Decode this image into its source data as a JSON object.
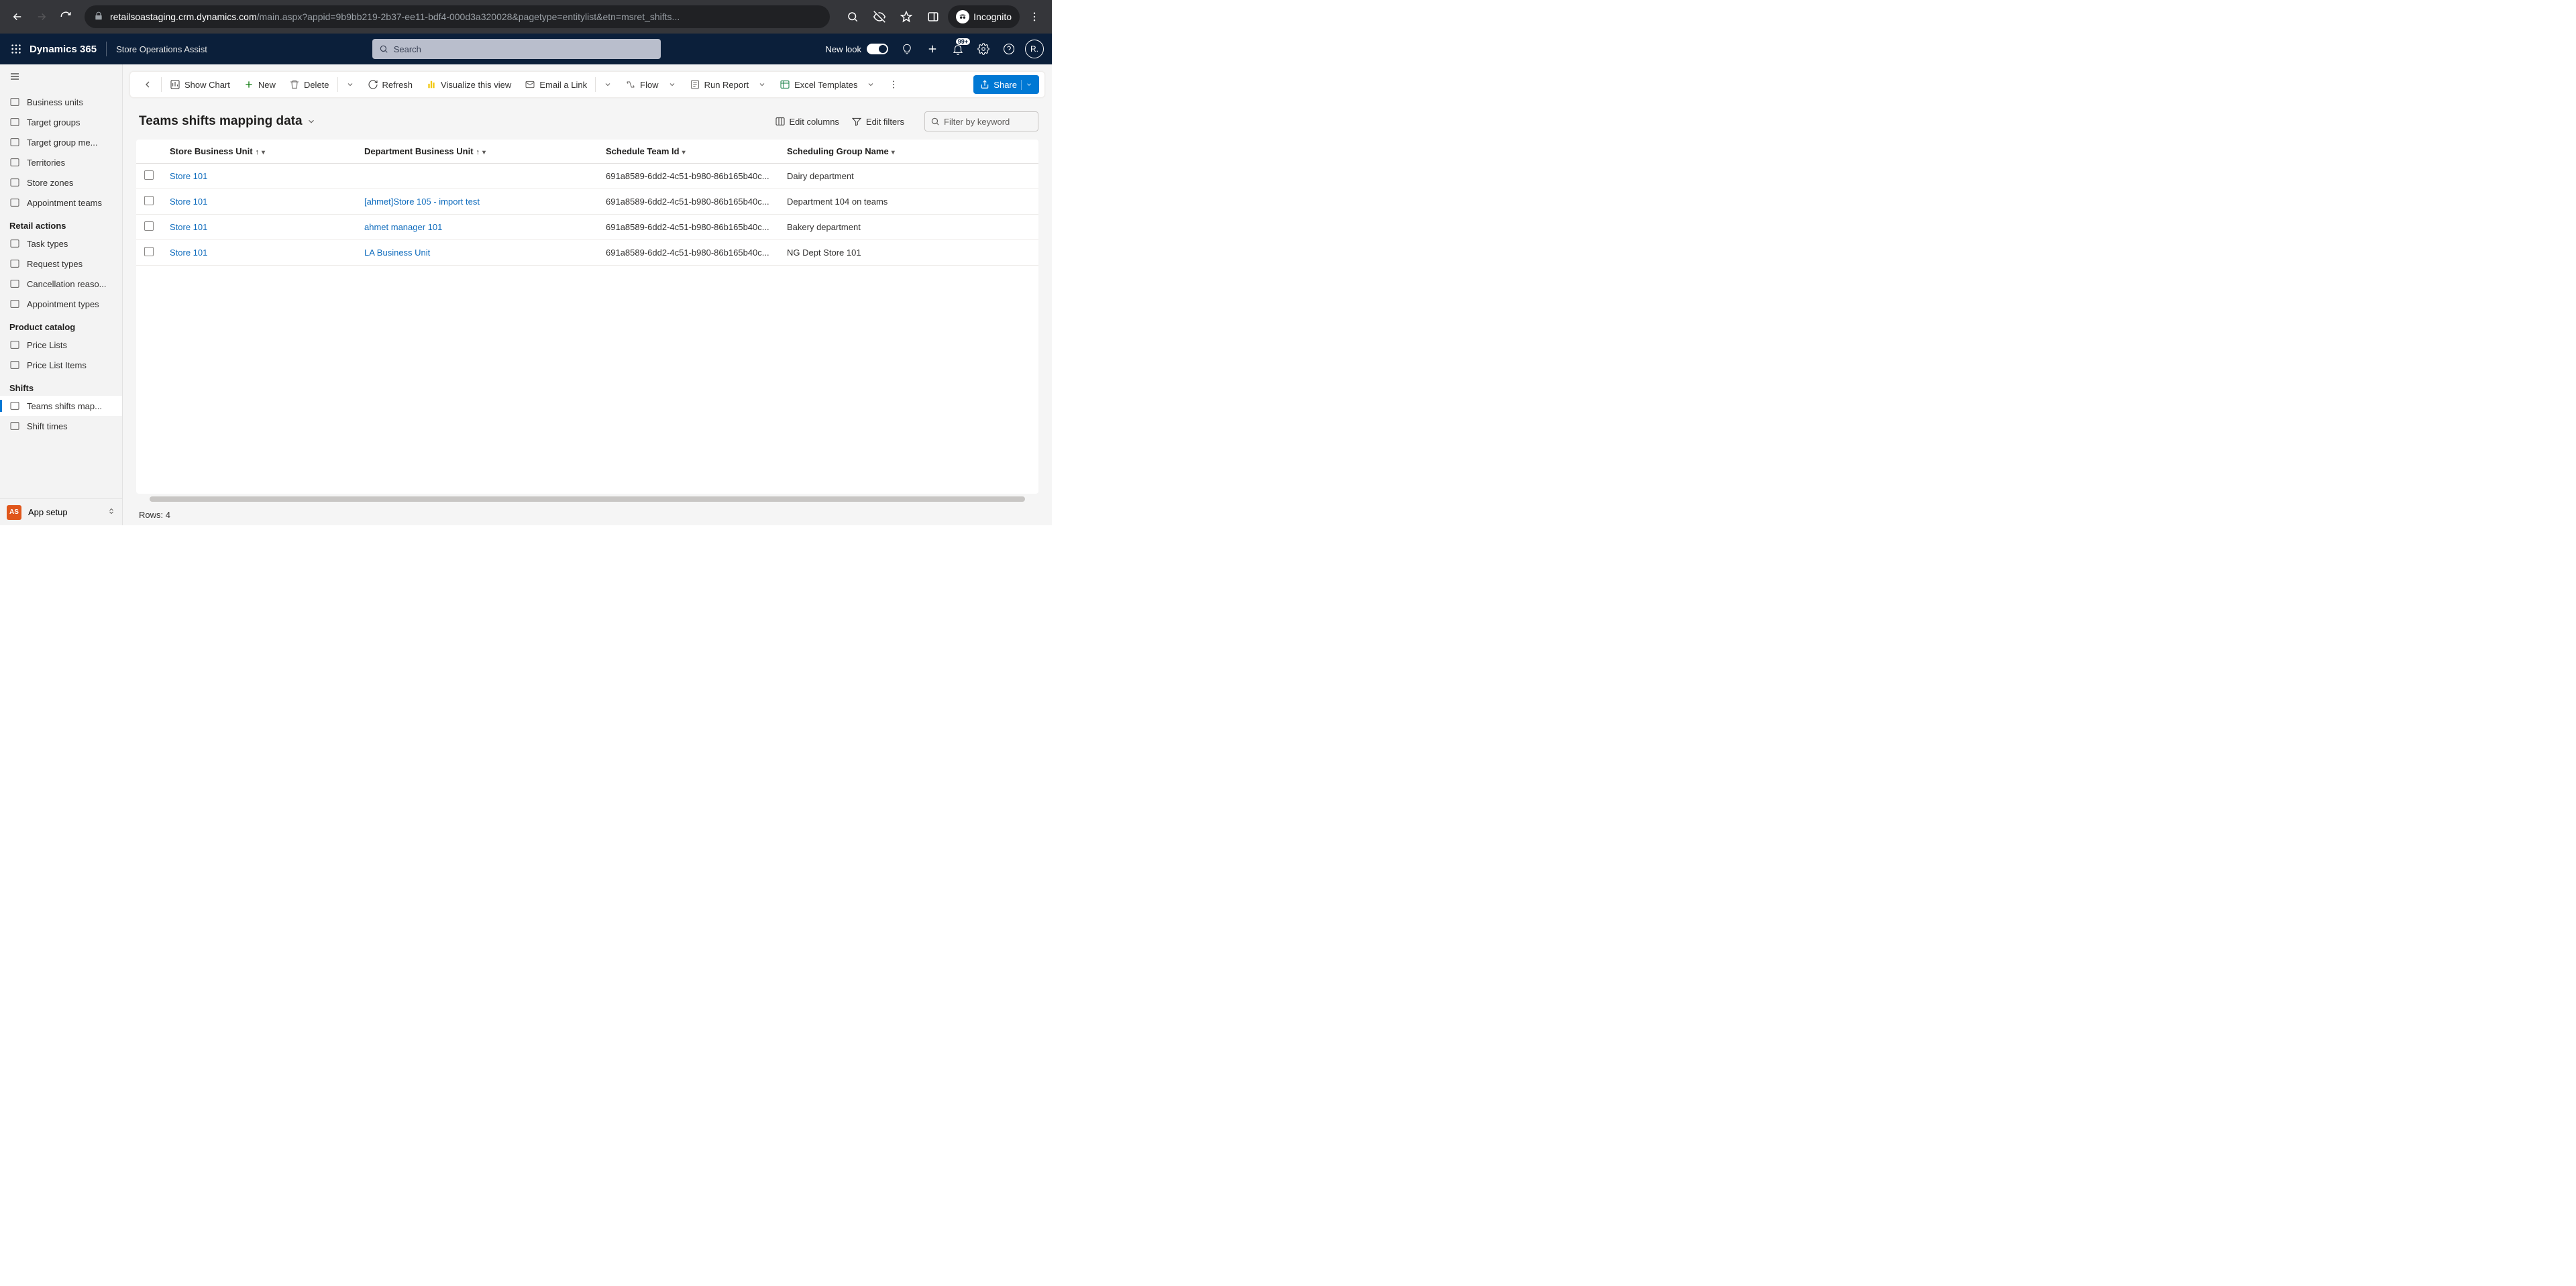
{
  "browser": {
    "url_host": "retailsoastaging.crm.dynamics.com",
    "url_path": "/main.aspx?appid=9b9bb219-2b37-ee11-bdf4-000d3a320028&pagetype=entitylist&etn=msret_shifts...",
    "incognito_label": "Incognito"
  },
  "header": {
    "brand": "Dynamics 365",
    "app_name": "Store Operations Assist",
    "search_placeholder": "Search",
    "new_look": "New look",
    "notification_badge": "99+",
    "avatar_initial": "R."
  },
  "sidebar": {
    "items_top": [
      {
        "label": "Business units"
      },
      {
        "label": "Target groups"
      },
      {
        "label": "Target group me..."
      },
      {
        "label": "Territories"
      },
      {
        "label": "Store zones"
      },
      {
        "label": "Appointment teams"
      }
    ],
    "section_retail": "Retail actions",
    "items_retail": [
      {
        "label": "Task types"
      },
      {
        "label": "Request types"
      },
      {
        "label": "Cancellation reaso..."
      },
      {
        "label": "Appointment types"
      }
    ],
    "section_catalog": "Product catalog",
    "items_catalog": [
      {
        "label": "Price Lists"
      },
      {
        "label": "Price List Items"
      }
    ],
    "section_shifts": "Shifts",
    "items_shifts": [
      {
        "label": "Teams shifts map...",
        "active": true
      },
      {
        "label": "Shift times"
      }
    ],
    "footer": {
      "sq": "AS",
      "label": "App setup"
    }
  },
  "commands": {
    "show_chart": "Show Chart",
    "new": "New",
    "delete": "Delete",
    "refresh": "Refresh",
    "visualize": "Visualize this view",
    "email": "Email a Link",
    "flow": "Flow",
    "report": "Run Report",
    "excel": "Excel Templates",
    "share": "Share"
  },
  "view": {
    "title": "Teams shifts mapping data",
    "edit_columns": "Edit columns",
    "edit_filters": "Edit filters",
    "filter_placeholder": "Filter by keyword"
  },
  "columns": {
    "c1": "Store Business Unit",
    "c2": "Department Business Unit",
    "c3": "Schedule Team Id",
    "c4": "Scheduling Group Name"
  },
  "rows": [
    {
      "store": "Store 101",
      "dept": "",
      "team": "691a8589-6dd2-4c51-b980-86b165b40c...",
      "group": "Dairy department"
    },
    {
      "store": "Store 101",
      "dept": "[ahmet]Store 105 - import test",
      "team": "691a8589-6dd2-4c51-b980-86b165b40c...",
      "group": "Department 104 on teams"
    },
    {
      "store": "Store 101",
      "dept": "ahmet manager 101",
      "team": "691a8589-6dd2-4c51-b980-86b165b40c...",
      "group": "Bakery department"
    },
    {
      "store": "Store 101",
      "dept": "LA Business Unit",
      "team": "691a8589-6dd2-4c51-b980-86b165b40c...",
      "group": "NG Dept Store 101"
    }
  ],
  "status": {
    "rows_label": "Rows: 4"
  }
}
